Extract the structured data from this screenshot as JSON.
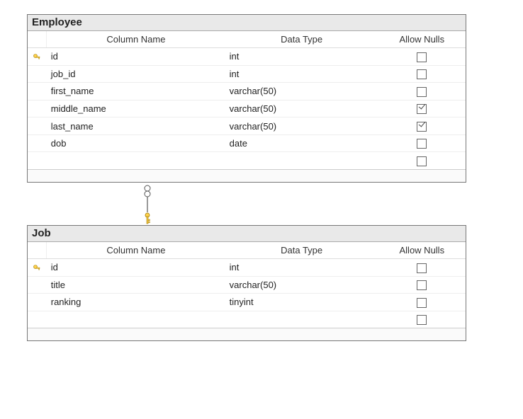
{
  "tables": [
    {
      "title": "Employee",
      "headers": {
        "name": "Column Name",
        "type": "Data Type",
        "nulls": "Allow Nulls"
      },
      "rows": [
        {
          "pk": true,
          "name": "id",
          "type": "int",
          "allow_nulls": false
        },
        {
          "pk": false,
          "name": "job_id",
          "type": "int",
          "allow_nulls": false
        },
        {
          "pk": false,
          "name": "first_name",
          "type": "varchar(50)",
          "allow_nulls": false
        },
        {
          "pk": false,
          "name": "middle_name",
          "type": "varchar(50)",
          "allow_nulls": true
        },
        {
          "pk": false,
          "name": "last_name",
          "type": "varchar(50)",
          "allow_nulls": true
        },
        {
          "pk": false,
          "name": "dob",
          "type": "date",
          "allow_nulls": false
        }
      ]
    },
    {
      "title": "Job",
      "headers": {
        "name": "Column Name",
        "type": "Data Type",
        "nulls": "Allow Nulls"
      },
      "rows": [
        {
          "pk": true,
          "name": "id",
          "type": "int",
          "allow_nulls": false
        },
        {
          "pk": false,
          "name": "title",
          "type": "varchar(50)",
          "allow_nulls": false
        },
        {
          "pk": false,
          "name": "ranking",
          "type": "tinyint",
          "allow_nulls": false
        }
      ]
    }
  ],
  "relationship": {
    "from_table": "Employee",
    "from_column": "job_id",
    "to_table": "Job",
    "to_column": "id",
    "type": "many-to-one"
  }
}
